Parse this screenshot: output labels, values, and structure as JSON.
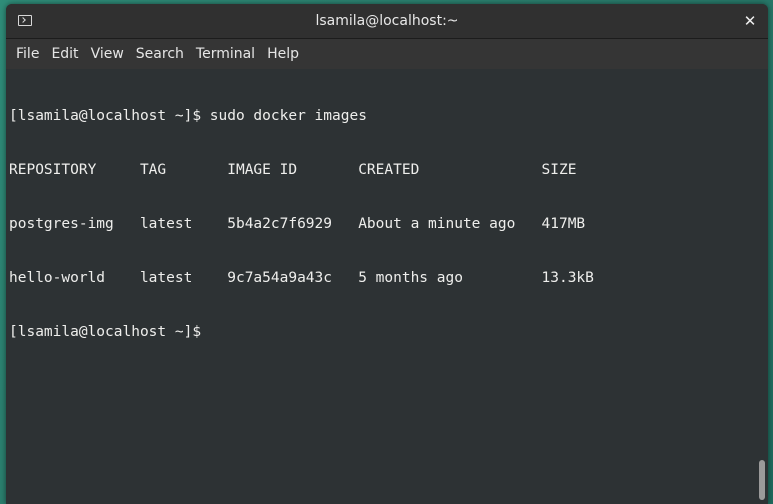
{
  "window": {
    "title": "lsamila@localhost:~",
    "close_label": "✕"
  },
  "menu": {
    "items": [
      "File",
      "Edit",
      "View",
      "Search",
      "Terminal",
      "Help"
    ]
  },
  "terminal": {
    "lines": [
      "[lsamila@localhost ~]$ sudo docker images",
      "REPOSITORY     TAG       IMAGE ID       CREATED              SIZE",
      "postgres-img   latest    5b4a2c7f6929   About a minute ago   417MB",
      "hello-world    latest    9c7a54a9a43c   5 months ago         13.3kB",
      "[lsamila@localhost ~]$ "
    ]
  },
  "colors": {
    "terminal_bg": "#2d3234",
    "terminal_fg": "#eeeeec",
    "titlebar_bg": "#303030",
    "desktop_accent": "#2a7f6f"
  },
  "icons": {
    "app_icon": "terminal-icon",
    "close": "close-icon"
  }
}
